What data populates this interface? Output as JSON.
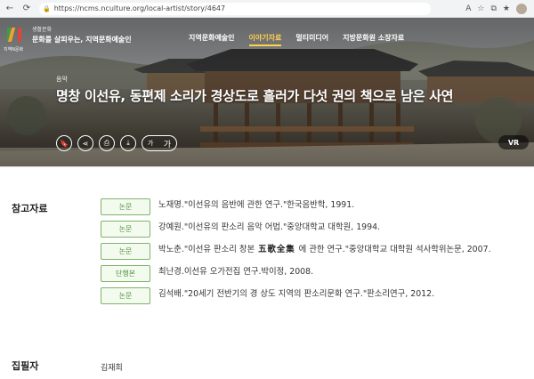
{
  "browser": {
    "url": "https://ncms.nculture.org/local-artist/story/4647",
    "icons": [
      "lock-icon",
      "read-aloud-icon",
      "favorite-icon",
      "refresh-icon",
      "profile-avatar"
    ]
  },
  "header": {
    "logo_text": "지역N문화",
    "brand_small": "생활문화",
    "brand_main": "문화를 살피우는, 지역문화예술인",
    "nav": [
      {
        "label": "지역문화예술인",
        "active": false
      },
      {
        "label": "이야기자료",
        "active": true
      },
      {
        "label": "멀티미디어",
        "active": false
      },
      {
        "label": "지방문화원 소장자료",
        "active": false
      }
    ]
  },
  "hero": {
    "category": "음악",
    "title": "명창 이선유, 동편제 소리가 경상도로 흘러가 다섯 권의 책으로 남은 사연",
    "font_small": "가",
    "font_large": "가",
    "vr_label": "VR"
  },
  "references": {
    "heading": "참고자료",
    "items": [
      {
        "type": "논문",
        "text": "노재명.\"이선유의 음반에 관한 연구.\"한국음반학, 1991."
      },
      {
        "type": "논문",
        "text": "강예원.\"이선유의 판소리 음악 어법.\"중앙대학교 대학원, 1994."
      },
      {
        "type": "논문",
        "text_before": "박노춘.\"이선유 판소리 창본",
        "hanja": "五歌全集",
        "text_after": "에 관한 연구.\"중앙대학교 대학원 석사학위논문, 2007."
      },
      {
        "type": "단행본",
        "text": "최난경.이선유 오가전집 연구.박이정, 2008."
      },
      {
        "type": "논문",
        "text": "김석배.\"20세기 전반기의 경 상도 지역의 판소리문화 연구.\"판소리연구, 2012."
      }
    ]
  },
  "writer": {
    "heading": "집필자",
    "value": "김재희"
  },
  "colors": {
    "accent": "#ffd24a",
    "badge_border": "#7fb36a",
    "badge_text": "#4f8f3c"
  }
}
